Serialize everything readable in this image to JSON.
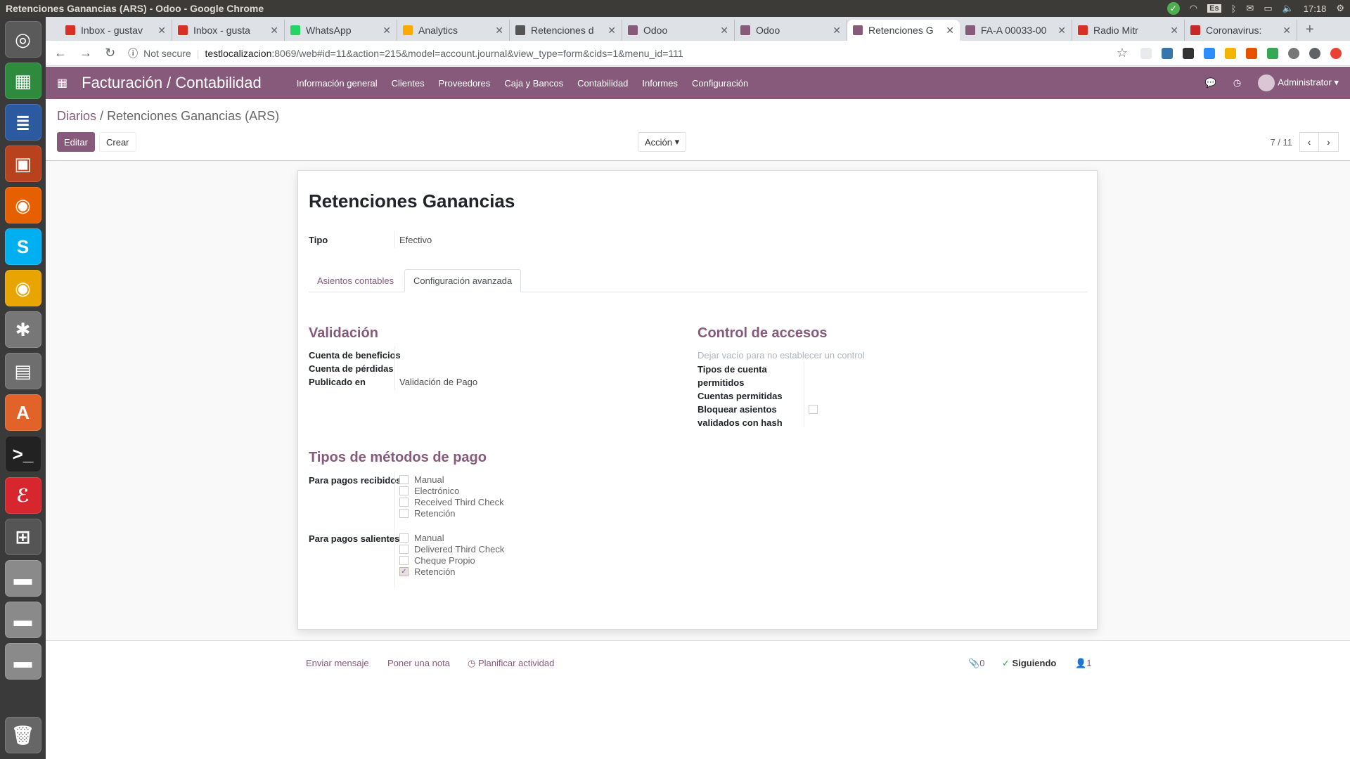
{
  "os": {
    "window_title": "Retenciones Ganancias (ARS) - Odoo - Google Chrome",
    "keyboard_layout": "Es",
    "clock": "17:18"
  },
  "browser": {
    "tabs": [
      {
        "label": "Inbox - gustav",
        "icon": "gmail-icon",
        "color": "#d93025"
      },
      {
        "label": "Inbox - gusta",
        "icon": "gmail-icon",
        "color": "#d93025"
      },
      {
        "label": "WhatsApp",
        "icon": "whatsapp-icon",
        "color": "#25d366"
      },
      {
        "label": "Analytics",
        "icon": "analytics-icon",
        "color": "#f9ab00"
      },
      {
        "label": "Retenciones d",
        "icon": "document-icon",
        "color": "#555555"
      },
      {
        "label": "Odoo",
        "icon": "odoo-icon",
        "color": "#875a7b"
      },
      {
        "label": "Odoo",
        "icon": "odoo-icon",
        "color": "#875a7b"
      },
      {
        "label": "Retenciones G",
        "icon": "odoo-icon",
        "color": "#875a7b",
        "active": true
      },
      {
        "label": "FA-A 00033-00",
        "icon": "odoo-icon",
        "color": "#875a7b"
      },
      {
        "label": "Radio Mitr",
        "icon": "radio-icon",
        "color": "#d93025"
      },
      {
        "label": "Coronavirus:",
        "icon": "news-icon",
        "color": "#c62828"
      }
    ],
    "security": "Not secure",
    "url_host": "testlocalizacion",
    "url_rest": ":8069/web#id=11&action=215&model=account.journal&view_type=form&cids=1&menu_id=111"
  },
  "app": {
    "brand": "Facturación / Contabilidad",
    "menu": [
      "Información general",
      "Clientes",
      "Proveedores",
      "Caja y Bancos",
      "Contabilidad",
      "Informes",
      "Configuración"
    ],
    "user": "Administrator"
  },
  "control": {
    "breadcrumb_parent": "Diarios",
    "breadcrumb_sep": "/",
    "breadcrumb_current": "Retenciones Ganancias (ARS)",
    "edit": "Editar",
    "create": "Crear",
    "action": "Acción",
    "pager": "7 / 11"
  },
  "form": {
    "title": "Retenciones Ganancias",
    "tipo_label": "Tipo",
    "tipo_value": "Efectivo",
    "tabs": [
      "Asientos contables",
      "Configuración avanzada"
    ],
    "validacion": {
      "title": "Validación",
      "profit_label": "Cuenta de beneficios",
      "loss_label": "Cuenta de pérdidas",
      "posted_label": "Publicado en",
      "posted_value": "Validación de Pago"
    },
    "access": {
      "title": "Control de accesos",
      "hint": "Dejar vacío para no establecer un control",
      "types_label_1": "Tipos de cuenta",
      "types_label_2": "permitidos",
      "accounts_label": "Cuentas permitidas",
      "lock_label_1": "Bloquear asientos",
      "lock_label_2": "validados con hash",
      "lock_checked": false
    },
    "payment_methods": {
      "title": "Tipos de métodos de pago",
      "inbound_label": "Para pagos recibidos",
      "inbound": [
        {
          "label": "Manual",
          "checked": false
        },
        {
          "label": "Electrónico",
          "checked": false
        },
        {
          "label": "Received Third Check",
          "checked": false
        },
        {
          "label": "Retención",
          "checked": false
        }
      ],
      "outbound_label": "Para pagos salientes",
      "outbound": [
        {
          "label": "Manual",
          "checked": false
        },
        {
          "label": "Delivered Third Check",
          "checked": false
        },
        {
          "label": "Cheque Propio",
          "checked": false
        },
        {
          "label": "Retención",
          "checked": true
        }
      ]
    }
  },
  "chatter": {
    "send_message": "Enviar mensaje",
    "log_note": "Poner una nota",
    "schedule": "Planificar actividad",
    "attachments": "0",
    "following": "Siguiendo",
    "followers": "1"
  }
}
